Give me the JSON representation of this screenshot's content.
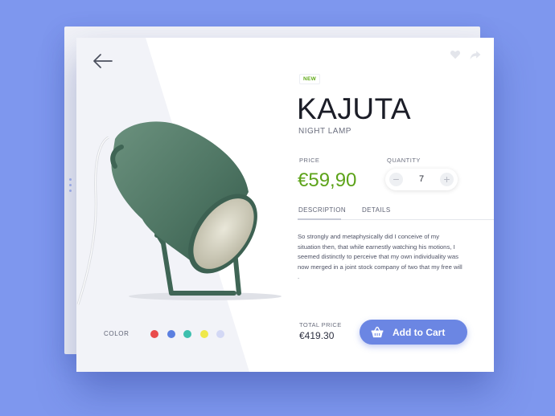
{
  "product": {
    "badge": "NEW",
    "title": "KAJUTA",
    "subtitle": "NIGHT LAMP",
    "price_label": "PRICE",
    "price": "€59,90",
    "quantity_label": "QUANTITY",
    "quantity": "7",
    "minus_label": "−",
    "plus_label": "+"
  },
  "tabs": [
    {
      "label": "DESCRIPTION",
      "active": true
    },
    {
      "label": "DETAILS",
      "active": false
    }
  ],
  "description": "So strongly and metaphysically did I conceive of my situation then, that while earnestly watching his motions, I seemed distinctly to perceive that my own individuality was now merged in a joint stock company of two that my free will .",
  "total": {
    "label": "TOTAL PRICE",
    "value": "€419.30"
  },
  "cart": {
    "label": "Add to Cart",
    "icon": "basket-icon"
  },
  "colors": {
    "label": "COLOR",
    "swatches": [
      "#e94b4b",
      "#5b7fe0",
      "#3dbfae",
      "#efe84a",
      "#d3d8f5"
    ]
  },
  "icons": [
    "back-arrow-icon",
    "heart-icon",
    "share-icon",
    "basket-icon"
  ],
  "theme": {
    "background": "#7e97ee",
    "accent": "#6b86e3",
    "price_color": "#5da31a",
    "lamp_color": "#4e7563"
  }
}
